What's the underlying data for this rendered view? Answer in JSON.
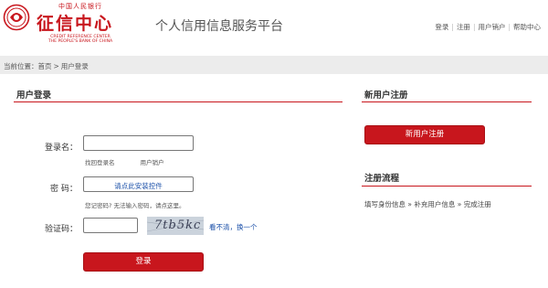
{
  "header": {
    "logo": {
      "top_text": "中国人民银行",
      "main_text": "征信中心",
      "en_line1": "CREDIT REFERENCE CENTER",
      "en_line2": "THE PEOPLE'S BANK OF CHINA"
    },
    "site_title": "个人信用信息服务平台",
    "links": [
      "登录",
      "注册",
      "用户销户",
      "帮助中心"
    ]
  },
  "breadcrumb": {
    "prefix": "当前位置：",
    "items": [
      "首页",
      "用户登录"
    ]
  },
  "login": {
    "title": "用户登录",
    "username_label": "登录名：",
    "username_value": "",
    "username_links": [
      "找回登录名",
      "用户销户"
    ],
    "password_label": "密  码：",
    "password_control_text": "请点此安装控件",
    "password_hint": "您记密码?      无法输入密码，请点这里。",
    "captcha_label": "验证码：",
    "captcha_value": "",
    "captcha_image_text": "7tb5kc",
    "captcha_refresh": "看不清，换一个",
    "submit_label": "登录"
  },
  "register": {
    "title": "新用户注册",
    "button_label": "新用户注册",
    "flow_title": "注册流程",
    "flow_steps": "填写身份信息 » 补充用户信息 » 完成注册"
  },
  "colors": {
    "brand_red": "#c8161d",
    "link_blue": "#1a4fa8",
    "crumb_bg": "#ececec"
  }
}
